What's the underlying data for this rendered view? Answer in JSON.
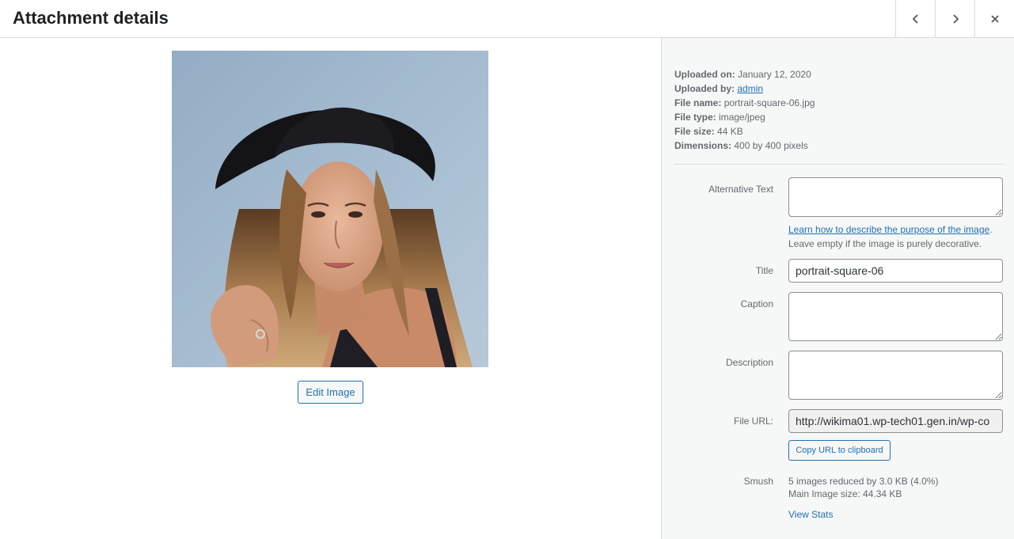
{
  "header": {
    "title": "Attachment details",
    "prev_icon": "chevron-left-icon",
    "next_icon": "chevron-right-icon",
    "close_icon": "close-icon"
  },
  "preview": {
    "edit_label": "Edit Image"
  },
  "meta": {
    "uploaded_on_label": "Uploaded on:",
    "uploaded_on": "January 12, 2020",
    "uploaded_by_label": "Uploaded by:",
    "uploaded_by": "admin",
    "file_name_label": "File name:",
    "file_name": "portrait-square-06.jpg",
    "file_type_label": "File type:",
    "file_type": "image/jpeg",
    "file_size_label": "File size:",
    "file_size": "44 KB",
    "dimensions_label": "Dimensions:",
    "dimensions": "400 by 400 pixels"
  },
  "form": {
    "alt_label": "Alternative Text",
    "alt_value": "",
    "alt_help_link": "Learn how to describe the purpose of the image",
    "alt_help_period": ".",
    "alt_help_text": "Leave empty if the image is purely decorative.",
    "title_label": "Title",
    "title_value": "portrait-square-06",
    "caption_label": "Caption",
    "caption_value": "",
    "description_label": "Description",
    "description_value": "",
    "url_label": "File URL:",
    "url_value": "http://wikima01.wp-tech01.gen.in/wp-co",
    "copy_label": "Copy URL to clipboard"
  },
  "smush": {
    "label": "Smush",
    "line1": "5 images reduced by 3.0 KB (4.0%)",
    "line2": "Main Image size: 44.34 KB",
    "view_stats": "View Stats"
  },
  "colors": {
    "accent": "#2271b1",
    "sidebar_bg": "#f6f7f7",
    "border": "#dcdcde"
  }
}
